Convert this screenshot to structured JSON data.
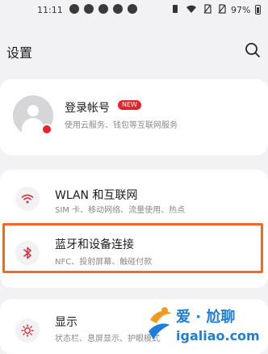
{
  "status_bar": {
    "time": "11:11",
    "battery": "97%"
  },
  "header": {
    "title": "设置",
    "search_icon": "search-icon"
  },
  "account": {
    "title": "登录帐号",
    "badge": "NEW",
    "subtitle": "使用云服务、钱包等互联网服务"
  },
  "items": [
    {
      "title": "WLAN 和互联网",
      "subtitle": "SIM 卡、移动网络、流量使用、热点",
      "icon": "wifi-icon"
    },
    {
      "title": "蓝牙和设备连接",
      "subtitle": "NFC、投射屏幕、触碰付款",
      "icon": "bluetooth-icon"
    },
    {
      "title": "显示",
      "subtitle": "状态栏、息屏显示、护眼模式",
      "icon": "brightness-icon"
    }
  ],
  "watermark": {
    "brand": "爱 · 尬聊",
    "url": "igaliao.com"
  },
  "colors": {
    "highlight": "#f06b2a",
    "badge": "#e4232a",
    "watermark": "#1d7fd9"
  }
}
